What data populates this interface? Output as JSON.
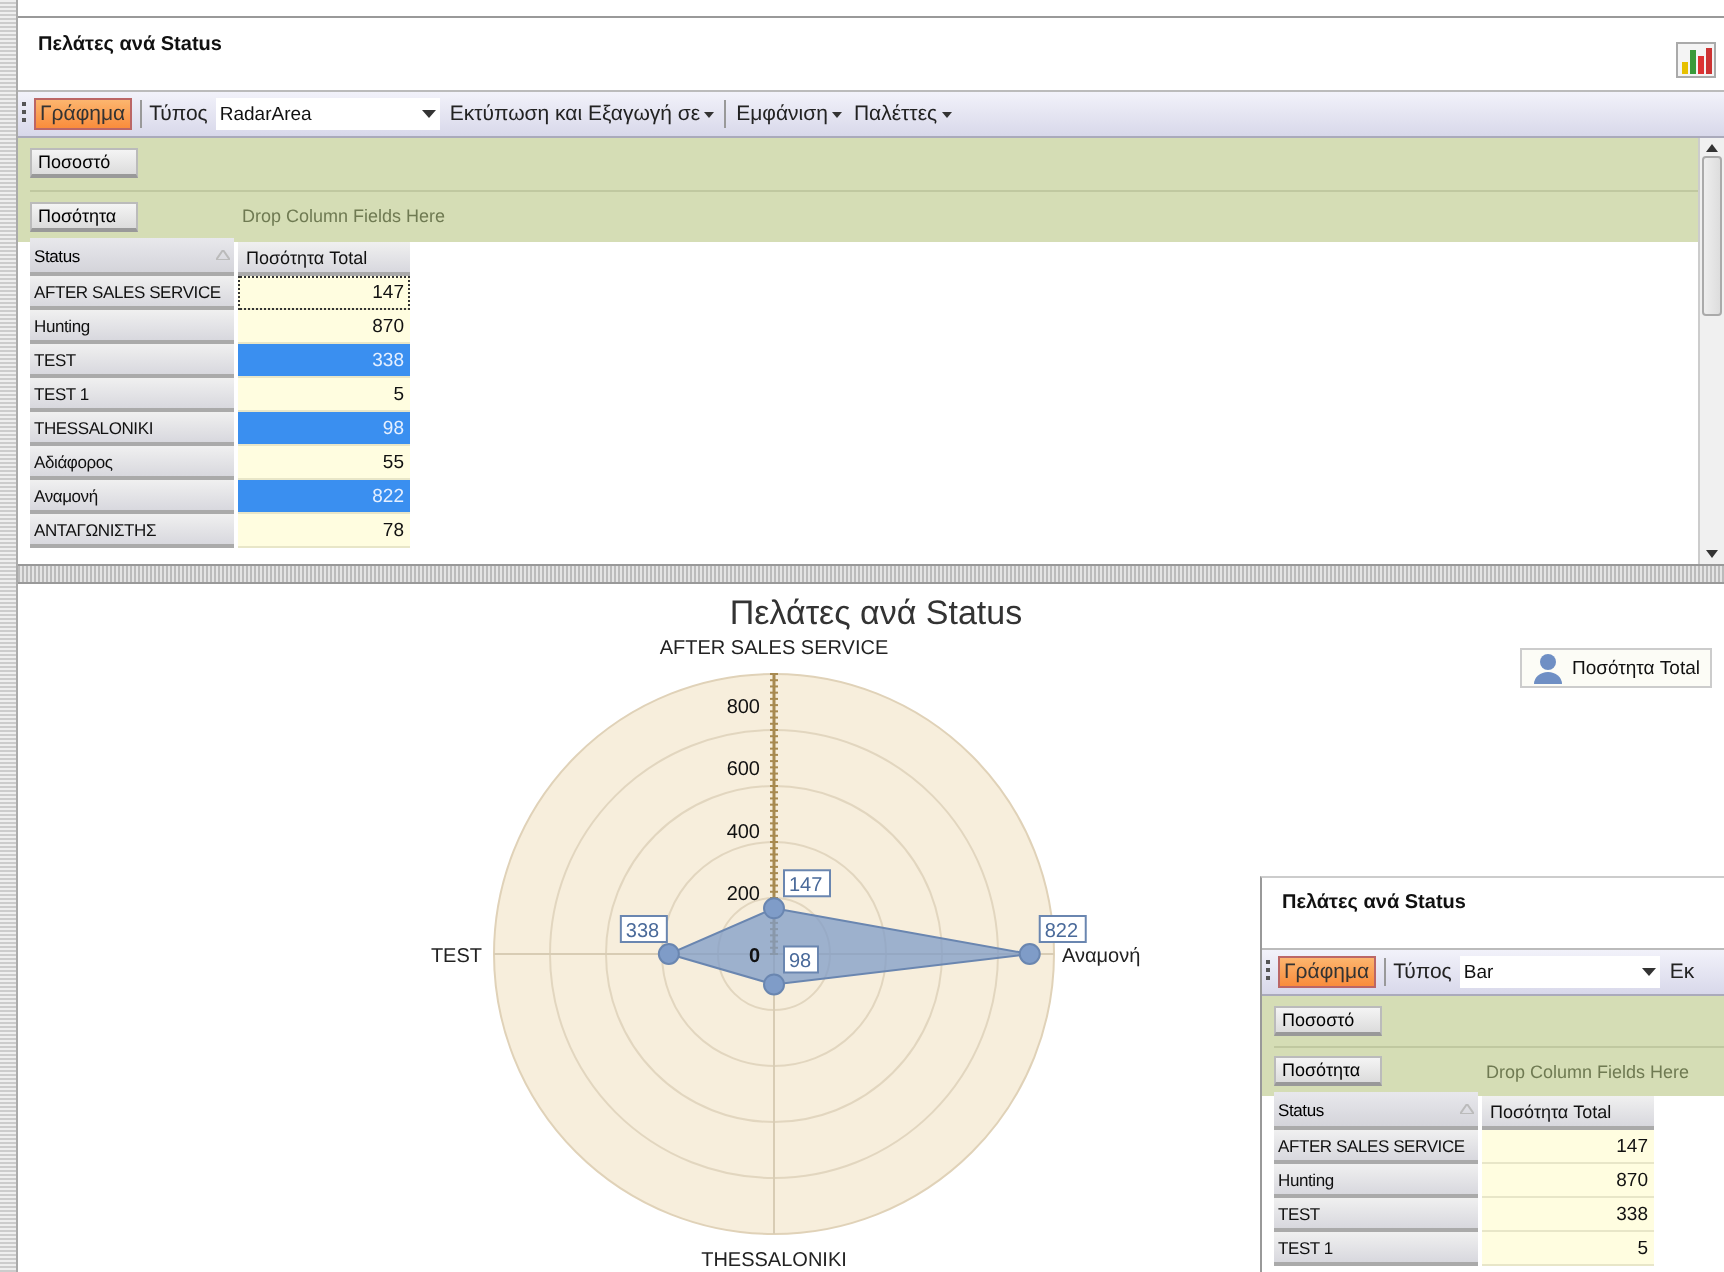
{
  "window": {
    "title": "Πελάτες ανά Status"
  },
  "toolbar": {
    "chart_button": {
      "label": "Γράφημα",
      "selected": true
    },
    "type_label": "Τύπος",
    "type_value": "RadarArea",
    "menus": [
      "Εκτύπωση και Εξαγωγή σε",
      "Εμφάνιση",
      "Παλέττες"
    ]
  },
  "pivot": {
    "filter_fields": [
      "Ποσοστό"
    ],
    "data_fields": [
      "Ποσότητα"
    ],
    "column_placeholder": "Drop Column Fields Here",
    "row_header": "Status",
    "column_header": "Ποσότητα Total",
    "rows": [
      {
        "label": "AFTER SALES SERVICE",
        "value": "147",
        "selected": false,
        "focused": true
      },
      {
        "label": "Hunting",
        "value": "870",
        "selected": false,
        "focused": false
      },
      {
        "label": "TEST",
        "value": "338",
        "selected": true,
        "focused": false
      },
      {
        "label": "TEST 1",
        "value": "5",
        "selected": false,
        "focused": false
      },
      {
        "label": "THESSALONIKI",
        "value": "98",
        "selected": true,
        "focused": false
      },
      {
        "label": "Αδιάφορος",
        "value": "55",
        "selected": false,
        "focused": false
      },
      {
        "label": "Αναμονή",
        "value": "822",
        "selected": true,
        "focused": false
      },
      {
        "label": "ΑΝΤΑΓΩΝΙΣΤΗΣ",
        "value": "78",
        "selected": false,
        "focused": false
      }
    ]
  },
  "chart": {
    "chart_data": {
      "type": "radar",
      "title": "Πελάτες ανά Status",
      "categories": [
        "AFTER SALES SERVICE",
        "Αναμονή",
        "THESSALONIKI",
        "TEST"
      ],
      "series": [
        {
          "name": "Ποσότητα Total",
          "color": "#7f9cc8",
          "values": [
            147,
            822,
            98,
            338
          ]
        }
      ],
      "ylim": [
        0,
        900
      ],
      "yticks": [
        0,
        200,
        400,
        600,
        800
      ],
      "data_labels": true
    }
  },
  "second_window": {
    "title": "Πελάτες ανά Status",
    "toolbar": {
      "chart_button": {
        "label": "Γράφημα",
        "selected": true
      },
      "type_label": "Τύπος",
      "type_value": "Bar",
      "menus": [
        "Εκ"
      ]
    },
    "pivot": {
      "filter_fields": [
        "Ποσοστό"
      ],
      "data_fields": [
        "Ποσότητα"
      ],
      "column_placeholder": "Drop Column Fields Here",
      "row_header": "Status",
      "column_header": "Ποσότητα Total",
      "rows": [
        {
          "label": "AFTER SALES SERVICE",
          "value": "147",
          "selected": false,
          "focused": false
        },
        {
          "label": "Hunting",
          "value": "870",
          "selected": false,
          "focused": false
        },
        {
          "label": "TEST",
          "value": "338",
          "selected": false,
          "focused": false
        },
        {
          "label": "TEST 1",
          "value": "5",
          "selected": false,
          "focused": false
        }
      ]
    }
  }
}
